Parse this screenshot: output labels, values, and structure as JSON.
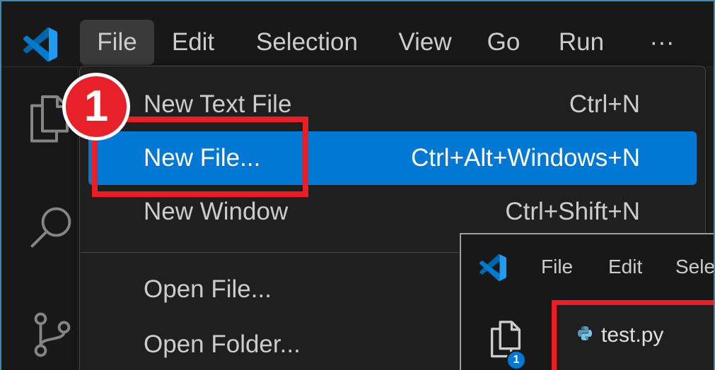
{
  "app": {
    "logo_icon": "vscode-logo-icon"
  },
  "menubar": {
    "items": [
      {
        "label": "File",
        "active": true
      },
      {
        "label": "Edit"
      },
      {
        "label": "Selection"
      },
      {
        "label": "View"
      },
      {
        "label": "Go"
      },
      {
        "label": "Run"
      },
      {
        "label": "···",
        "icon": "more-actions-icon"
      }
    ]
  },
  "activity_bar": {
    "icons": [
      "explorer-icon",
      "search-icon",
      "source-control-icon"
    ]
  },
  "file_menu": {
    "items": [
      {
        "label": "New Text File",
        "shortcut": "Ctrl+N"
      },
      {
        "label": "New File...",
        "shortcut": "Ctrl+Alt+Windows+N",
        "highlighted": true
      },
      {
        "label": "New Window",
        "shortcut": "Ctrl+Shift+N"
      },
      {
        "separator": true
      },
      {
        "label": "Open File..."
      },
      {
        "label": "Open Folder..."
      }
    ]
  },
  "annotation": {
    "step_number": "1"
  },
  "inset_window": {
    "logo_icon": "vscode-logo-icon",
    "menubar": {
      "items": [
        "File",
        "Edit",
        "Sele"
      ]
    },
    "activity_bar": {
      "icon": "explorer-icon",
      "badge": "1"
    },
    "explorer": {
      "file": {
        "name": "test.py",
        "icon": "python-file-icon"
      }
    }
  },
  "colors": {
    "titlebar_bg": "#181818",
    "editor_bg": "#1f1f1f",
    "menu_text": "#cccccc",
    "menu_highlight": "#0078d4",
    "annotation_red": "#ee1c25",
    "badge_blue": "#0078d4",
    "frame_border": "#3f88b5"
  }
}
